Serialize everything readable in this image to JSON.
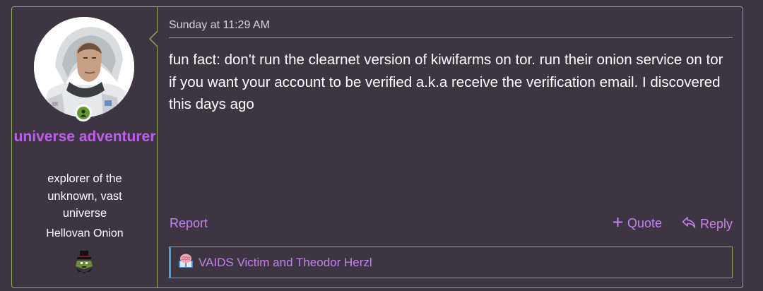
{
  "user": {
    "username": "universe adventurer",
    "custom_title": "explorer of the unknown, vast universe",
    "banner": "Hellovan Onion",
    "avatar_icon": "astronaut-avatar",
    "status_icon": "online-user-icon",
    "banner_icon": "black-hat-gnome-icon"
  },
  "post": {
    "date": "Sunday at 11:29 AM",
    "body": "fun fact: don't run the clearnet version of kiwifarms on tor. run their onion service on tor if you want your account to be verified a.k.a receive the verification email. I discovered this days ago"
  },
  "actions": {
    "report": "Report",
    "quote": "Quote",
    "reply": "Reply"
  },
  "reactions": {
    "text": "VAIDS Victim and Theodor Herzl",
    "icon": "brain-book-reaction-icon"
  },
  "colors": {
    "background": "#3d3542",
    "border": "#8fae5c",
    "username": "#c05cf0",
    "link": "#c881ef",
    "reaction_accent": "#4aa3df"
  }
}
